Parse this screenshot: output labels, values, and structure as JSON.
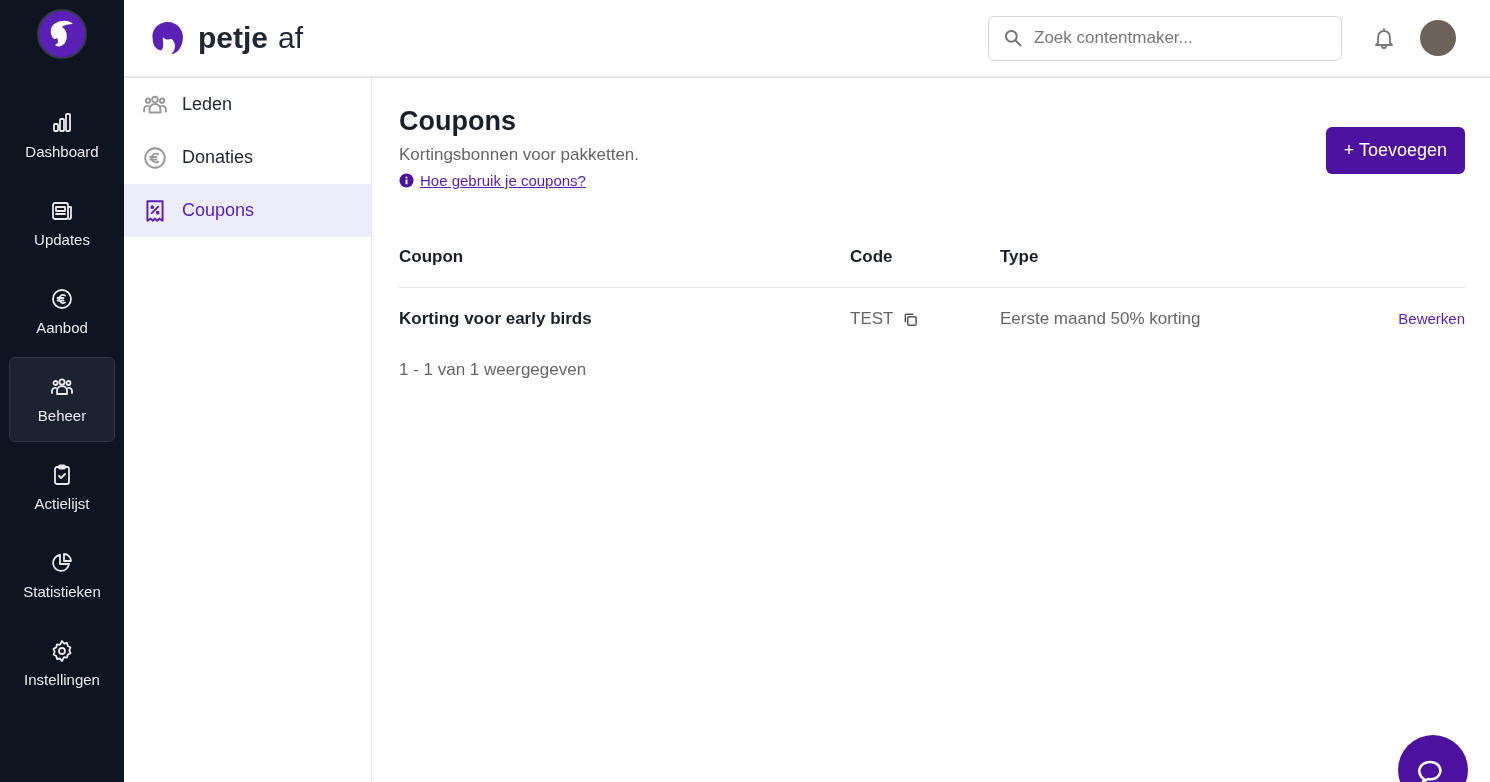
{
  "brand": {
    "name_bold": "petje",
    "name_light": "af"
  },
  "rail": [
    {
      "label": "Dashboard",
      "kind": "bars",
      "selected": false
    },
    {
      "label": "Updates",
      "kind": "news",
      "selected": false
    },
    {
      "label": "Aanbod",
      "kind": "euro",
      "selected": false
    },
    {
      "label": "Beheer",
      "kind": "people",
      "selected": true
    },
    {
      "label": "Actielijst",
      "kind": "clipboard",
      "selected": false
    },
    {
      "label": "Statistieken",
      "kind": "pie",
      "selected": false
    },
    {
      "label": "Instellingen",
      "kind": "gear",
      "selected": false
    }
  ],
  "search": {
    "placeholder": "Zoek contentmaker..."
  },
  "subnav": [
    {
      "label": "Leden",
      "kind": "people",
      "selected": false
    },
    {
      "label": "Donaties",
      "kind": "euro",
      "selected": false
    },
    {
      "label": "Coupons",
      "kind": "coupon",
      "selected": true
    }
  ],
  "page": {
    "title": "Coupons",
    "subtitle": "Kortingsbonnen voor pakketten.",
    "help_link": "Hoe gebruik je coupons?",
    "add_button": "+ Toevoegen"
  },
  "table": {
    "columns": [
      "Coupon",
      "Code",
      "Type"
    ],
    "rows": [
      {
        "coupon": "Korting voor early birds",
        "code": "TEST",
        "type": "Eerste maand 50% korting",
        "action": "Bewerken"
      }
    ],
    "footer": "1 - 1 van 1 weergegeven"
  }
}
